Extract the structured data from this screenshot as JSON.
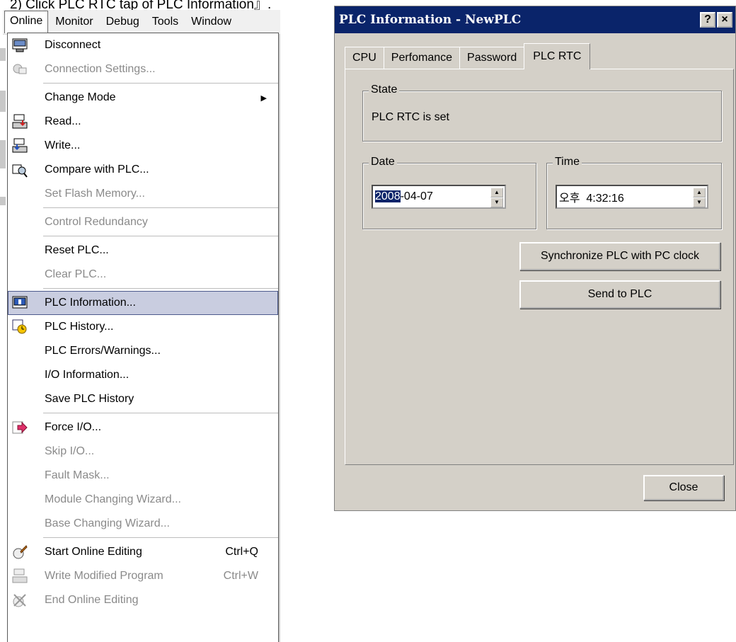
{
  "caption": "2) Click PLC RTC tap of PLC Information』.",
  "menubar": {
    "items": [
      "Online",
      "Monitor",
      "Debug",
      "Tools",
      "Window"
    ]
  },
  "menu": {
    "items": [
      {
        "label": "Disconnect",
        "icon": "disconnect-icon",
        "disabled": false
      },
      {
        "label": "Connection Settings...",
        "icon": "connection-settings-icon",
        "disabled": true
      },
      {
        "label": "Change Mode",
        "submenu": true,
        "disabled": false
      },
      {
        "label": "Read...",
        "icon": "read-icon",
        "disabled": false
      },
      {
        "label": "Write...",
        "icon": "write-icon",
        "disabled": false
      },
      {
        "label": "Compare with PLC...",
        "icon": "compare-icon",
        "disabled": false
      },
      {
        "label": "Set Flash Memory...",
        "disabled": true
      },
      {
        "label": "Control Redundancy",
        "disabled": true
      },
      {
        "label": "Reset PLC...",
        "disabled": false
      },
      {
        "label": "Clear PLC...",
        "disabled": true
      },
      {
        "label": "PLC Information...",
        "icon": "plc-information-icon",
        "disabled": false,
        "selected": true
      },
      {
        "label": "PLC History...",
        "icon": "plc-history-icon",
        "disabled": false
      },
      {
        "label": "PLC Errors/Warnings...",
        "disabled": false
      },
      {
        "label": "I/O Information...",
        "disabled": false
      },
      {
        "label": "Save PLC History",
        "disabled": false
      },
      {
        "label": "Force I/O...",
        "icon": "force-io-icon",
        "disabled": false
      },
      {
        "label": "Skip I/O...",
        "disabled": true
      },
      {
        "label": "Fault Mask...",
        "disabled": true
      },
      {
        "label": "Module Changing Wizard...",
        "disabled": true
      },
      {
        "label": "Base Changing Wizard...",
        "disabled": true
      },
      {
        "label": "Start Online Editing",
        "icon": "start-online-editing-icon",
        "shortcut": "Ctrl+Q",
        "disabled": false
      },
      {
        "label": "Write Modified Program",
        "icon": "write-modified-program-icon",
        "shortcut": "Ctrl+W",
        "disabled": true
      },
      {
        "label": "End Online Editing",
        "icon": "end-online-editing-icon",
        "disabled": true
      }
    ]
  },
  "dialog": {
    "title": "PLC Information - NewPLC",
    "help_button": "?",
    "close_x": "×",
    "tabs": [
      "CPU",
      "Perfomance",
      "Password",
      "PLC RTC"
    ],
    "active_tab": "PLC RTC",
    "state": {
      "caption": "State",
      "text": "PLC RTC is set"
    },
    "date": {
      "caption": "Date",
      "selected_part": "2008",
      "rest": "-04-07"
    },
    "time": {
      "caption": "Time",
      "ampm": "오후",
      "value": "4:32:16"
    },
    "sync_button": "Synchronize PLC with PC clock",
    "send_button": "Send to PLC",
    "close_button": "Close"
  },
  "colors": {
    "titlebar": "#0a246a",
    "dialog_face": "#d4d0c8",
    "menu_selected": "#c9cde0"
  }
}
